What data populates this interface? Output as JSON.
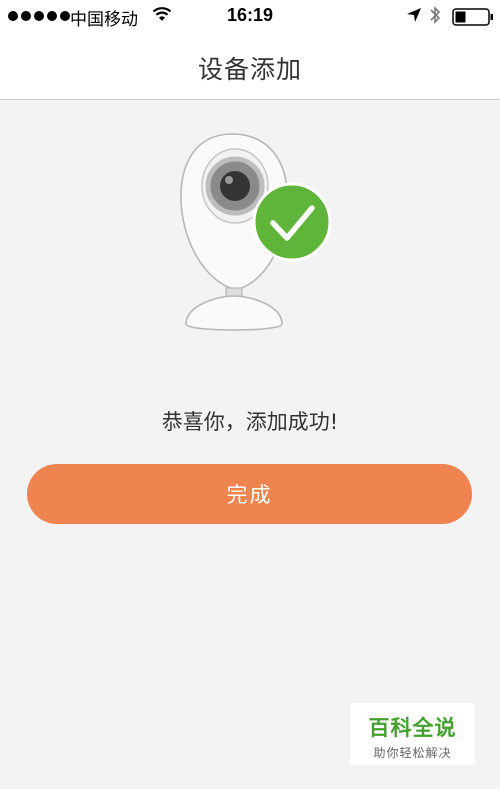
{
  "status_bar": {
    "carrier": "中国移动",
    "time": "16:19",
    "signal_bars": 5
  },
  "header": {
    "title": "设备添加"
  },
  "main": {
    "illustration": "camera-with-checkmark",
    "success_message": "恭喜你，添加成功!",
    "done_button_label": "完成"
  },
  "watermark": {
    "main": "百科全说",
    "sub": "助你轻松解决"
  },
  "colors": {
    "accent": "#f08450",
    "success_green": "#5fb43a",
    "background": "#f3f3f3"
  }
}
